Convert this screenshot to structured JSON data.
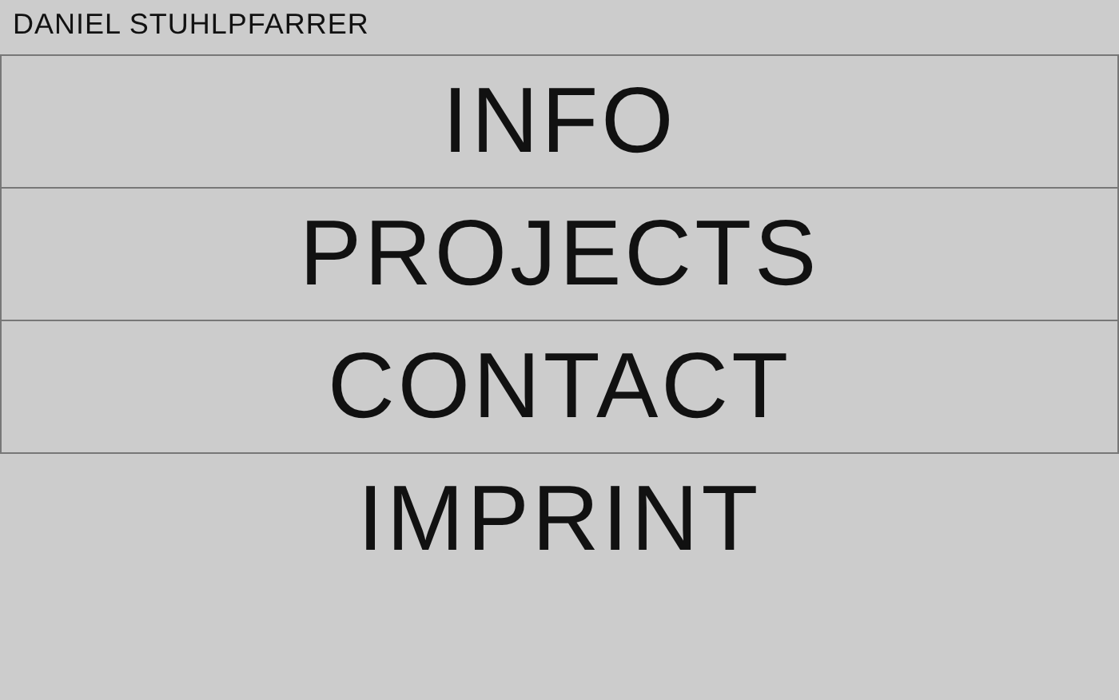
{
  "header": {
    "title": "DANIEL STUHLPFARRER"
  },
  "nav": [
    {
      "label": "INFO",
      "bordered": true
    },
    {
      "label": "PROJECTS",
      "bordered": true
    },
    {
      "label": "CONTACT",
      "bordered": true
    },
    {
      "label": "IMPRINT",
      "bordered": false
    }
  ]
}
